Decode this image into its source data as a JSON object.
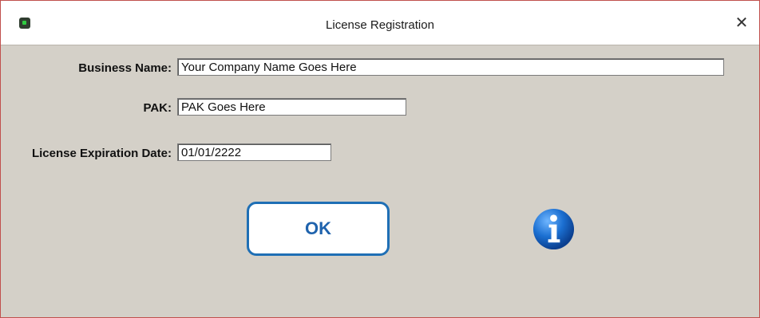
{
  "window": {
    "title": "License Registration",
    "close_glyph": "✕",
    "app_icon": "app-logo-icon"
  },
  "form": {
    "business_name": {
      "label": "Business Name:",
      "value": "Your Company Name Goes Here"
    },
    "pak": {
      "label": "PAK:",
      "value": "PAK Goes Here"
    },
    "expiration": {
      "label": "License Expiration Date:",
      "value": "01/01/2222"
    }
  },
  "actions": {
    "ok_label": "OK",
    "info_icon": "info-icon"
  },
  "colors": {
    "window_border": "#c0504d",
    "dialog_bg": "#d4d0c8",
    "button_border": "#1f6fb5",
    "button_text": "#1f63ad",
    "info_blue": "#1565c0"
  }
}
